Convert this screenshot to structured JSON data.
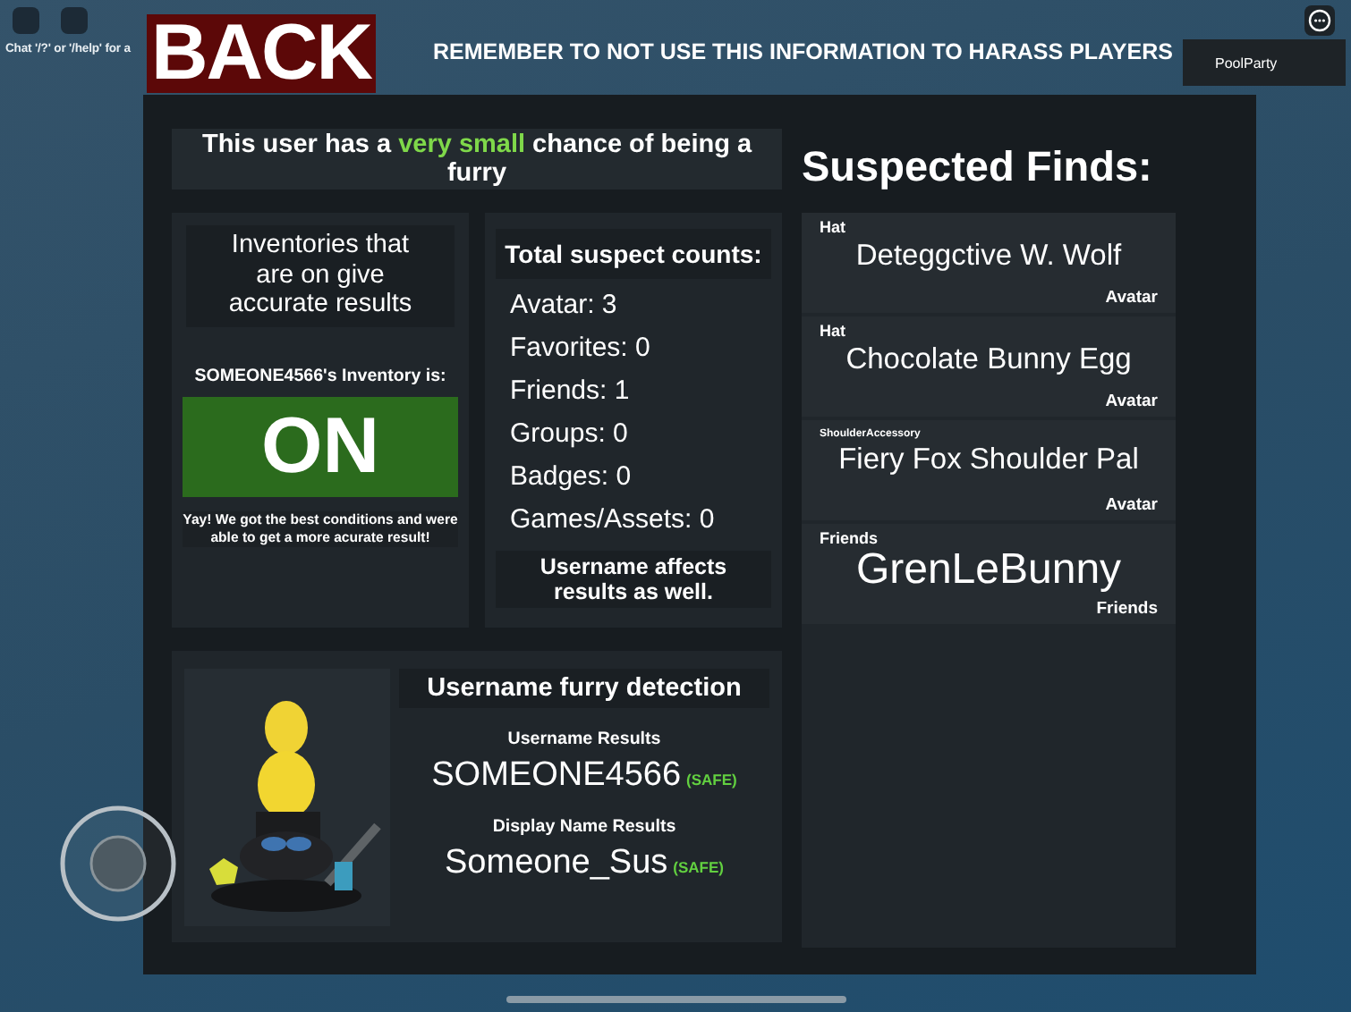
{
  "hud": {
    "chat_hint": "Chat '/?' or '/help' for a",
    "back_button": "BACK",
    "warning": "REMEMBER TO NOT USE THIS INFORMATION TO HARASS PLAYERS",
    "server_label": "PoolParty"
  },
  "header": "This user has a **very small** chance of being a furry",
  "inventory": {
    "note": "Inventories that are on give accurate results",
    "label": "SOMEONE4566's Inventory is:",
    "status": "ON",
    "message": "Yay! We got the best conditions and were able to get a more acurate result!"
  },
  "counts": {
    "title": "Total suspect counts:",
    "items": [
      "Avatar: 3",
      "Favorites: 0",
      "Friends: 1",
      "Groups: 0",
      "Badges: 0",
      "Games/Assets: 0"
    ],
    "footnote": "Username affects results as well."
  },
  "username_detection": {
    "title": "Username furry detection",
    "results": [
      {
        "label": "Username Results",
        "value": "SOMEONE4566",
        "verdict": "(SAFE)"
      },
      {
        "label": "Display Name Results",
        "value": "Someone_Sus",
        "verdict": "(SAFE)"
      }
    ]
  },
  "finds": {
    "title": "Suspected Finds:",
    "items": [
      {
        "kind": "item",
        "category": "Hat",
        "name": "Deteggctive W. Wolf",
        "source": "Avatar"
      },
      {
        "kind": "item",
        "category": "Hat",
        "name": "Chocolate Bunny Egg",
        "source": "Avatar"
      },
      {
        "kind": "accessory",
        "category": "ShoulderAccessory",
        "name": "Fiery Fox Shoulder Pal",
        "source": "Avatar"
      },
      {
        "kind": "friend",
        "category": "Friends",
        "name": "GrenLeBunny",
        "source": "Friends"
      }
    ]
  }
}
